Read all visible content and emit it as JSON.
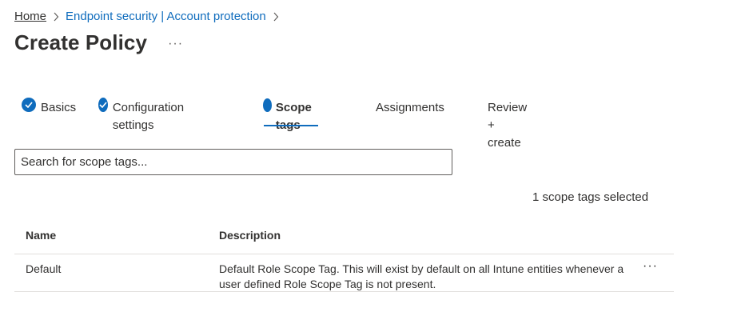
{
  "breadcrumb": {
    "home": "Home",
    "section": "Endpoint security | Account protection"
  },
  "header": {
    "title": "Create Policy",
    "more": "···"
  },
  "tabs": [
    {
      "label": "Basics",
      "state": "completed"
    },
    {
      "label": "Configuration settings",
      "state": "completed"
    },
    {
      "label": "Scope tags",
      "state": "active"
    },
    {
      "label": "Assignments",
      "state": "pending"
    },
    {
      "label": "Review + create",
      "state": "pending"
    }
  ],
  "search": {
    "placeholder": "Search for scope tags..."
  },
  "selection": {
    "summary": "1 scope tags selected"
  },
  "table": {
    "columns": [
      "Name",
      "Description"
    ],
    "rows": [
      {
        "name": "Default",
        "description_line1": "Default Role Scope Tag. This will exist by default on all Intune entities whenever a",
        "description_line2": "user defined Role Scope Tag is not present.",
        "more": "···"
      }
    ]
  },
  "colors": {
    "accent": "#0f6cbd",
    "text": "#323130",
    "divider": "#e1dfdd"
  },
  "icons": {
    "completed": "checkmark-circle-icon",
    "active": "filled-circle-icon",
    "separator": "chevron-right-icon"
  }
}
